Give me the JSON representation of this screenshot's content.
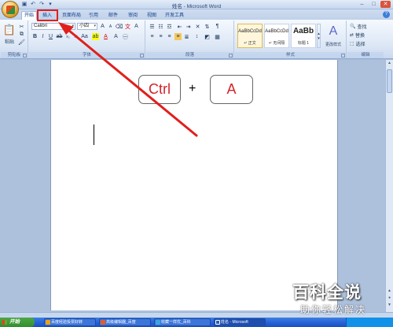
{
  "window": {
    "title": "姓名 - Microsoft Word",
    "qat_icons": [
      "save-icon",
      "undo-icon",
      "redo-icon",
      "dropdown-icon"
    ],
    "controls": [
      "minimize",
      "maximize",
      "close"
    ]
  },
  "tabs": [
    {
      "label": "开始",
      "active": true
    },
    {
      "label": "插入",
      "active": false
    },
    {
      "label": "页面布局",
      "active": false
    },
    {
      "label": "引用",
      "active": false
    },
    {
      "label": "邮件",
      "active": false
    },
    {
      "label": "审阅",
      "active": false
    },
    {
      "label": "视图",
      "active": false
    },
    {
      "label": "开发工具",
      "active": false
    }
  ],
  "ribbon": {
    "clipboard": {
      "group_label": "剪贴板",
      "paste_label": "粘贴"
    },
    "font": {
      "group_label": "字体",
      "font_name": "Calibri",
      "font_size": "小四"
    },
    "paragraph": {
      "group_label": "段落"
    },
    "styles": {
      "group_label": "样式",
      "items": [
        {
          "sample": "AaBbCcDd",
          "name": "正文",
          "selected": true
        },
        {
          "sample": "AaBbCcDd",
          "name": "无间隔",
          "selected": false
        },
        {
          "sample": "AaBb",
          "name": "标题 1",
          "selected": false
        }
      ],
      "change_styles_label": "更改样式"
    },
    "editing": {
      "group_label": "编辑",
      "find_label": "查找",
      "replace_label": "替换",
      "select_label": "选择"
    }
  },
  "document": {
    "key1": "Ctrl",
    "plus": "+",
    "key2": "A"
  },
  "taskbar": {
    "start_label": "开始",
    "items": [
      {
        "label": "百度经验投票好转",
        "color": "#e8a020"
      },
      {
        "label": "高级编辑器_百度",
        "color": "#e25b2a"
      },
      {
        "label": "收藏一样优_百科",
        "color": "#3aa5e0"
      },
      {
        "label": "姓名 - Microsoft",
        "color": "#2b5fb8",
        "active": true
      }
    ]
  },
  "watermark": {
    "title": "百科全说",
    "subtitle": "助你轻松解决"
  },
  "colors": {
    "highlight_red": "#e0201c",
    "key_text_red": "#d2232a"
  }
}
